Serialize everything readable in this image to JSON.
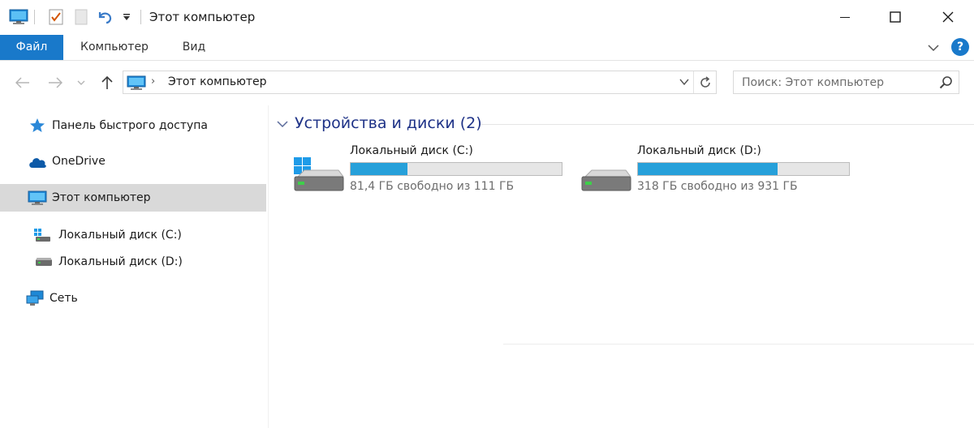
{
  "window": {
    "title": "Этот компьютер",
    "accent_color": "#1979ca",
    "quick_access_icons": [
      "monitor-icon",
      "properties-icon",
      "new-folder-icon",
      "undo-icon",
      "customize-dropdown-icon"
    ],
    "controls": [
      "minimize-icon",
      "maximize-icon",
      "close-icon"
    ]
  },
  "ribbon": {
    "tabs": [
      {
        "label": "Файл",
        "active": true
      },
      {
        "label": "Компьютер",
        "active": false
      },
      {
        "label": "Вид",
        "active": false
      }
    ],
    "expand_icon": "chevron-down-icon",
    "help_glyph": "?"
  },
  "navigation": {
    "buttons": [
      "back-arrow-icon",
      "forward-arrow-icon",
      "recent-dropdown-icon",
      "up-arrow-icon"
    ],
    "address": {
      "icon": "computer-icon",
      "separator": "›",
      "crumb": "Этот компьютер"
    },
    "search": {
      "placeholder": "Поиск: Этот компьютер",
      "value": ""
    }
  },
  "sidebar": {
    "items": [
      {
        "label": "Панель быстрого доступа",
        "icon": "star-icon",
        "selected": false
      },
      {
        "label": "OneDrive",
        "icon": "cloud-icon",
        "selected": false
      },
      {
        "label": "Этот компьютер",
        "icon": "computer-icon",
        "selected": true
      },
      {
        "label": "Локальный диск (C:)",
        "icon": "system-drive-icon",
        "selected": false
      },
      {
        "label": "Локальный диск (D:)",
        "icon": "drive-icon",
        "selected": false
      },
      {
        "label": "Сеть",
        "icon": "network-icon",
        "selected": false
      }
    ]
  },
  "content": {
    "group": {
      "title": "Устройства и диски (2)",
      "expanded": true
    },
    "drives": [
      {
        "name": "Локальный диск (C:)",
        "free_text": "81,4 ГБ свободно из 111 ГБ",
        "used_fraction": 0.27,
        "icon": "system-drive-icon"
      },
      {
        "name": "Локальный диск (D:)",
        "free_text": "318 ГБ свободно из 931 ГБ",
        "used_fraction": 0.66,
        "icon": "drive-icon"
      }
    ],
    "bar_color": "#26a0da"
  }
}
